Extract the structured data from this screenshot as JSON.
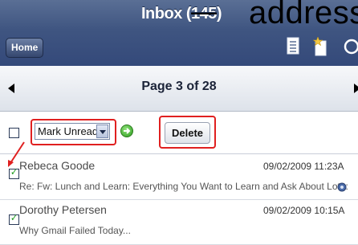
{
  "header": {
    "title_prefix": "Inbox (",
    "unread_count": "145",
    "title_suffix": ")",
    "overlay_text": "address",
    "home_label": "Home",
    "icons": [
      "document-icon",
      "new-item-icon",
      "refresh-icon"
    ]
  },
  "pager": {
    "label": "Page 3 of 28"
  },
  "actions": {
    "select_value": "Mark Unread",
    "delete_label": "Delete"
  },
  "messages": [
    {
      "sender": "Rebeca Goode",
      "date": "09/02/2009 11:23A",
      "subject": "Re: Fw: Lunch and Learn: Everything You Want to Learn and Ask About Lotu:",
      "checked": true
    },
    {
      "sender": "Dorothy Petersen",
      "date": "09/02/2009 10:15A",
      "subject": "Why Gmail Failed Today...",
      "checked": true
    }
  ],
  "colors": {
    "header_bg": "#3f5581",
    "highlight_red": "#e02020",
    "check_green": "#1a9a1a"
  }
}
